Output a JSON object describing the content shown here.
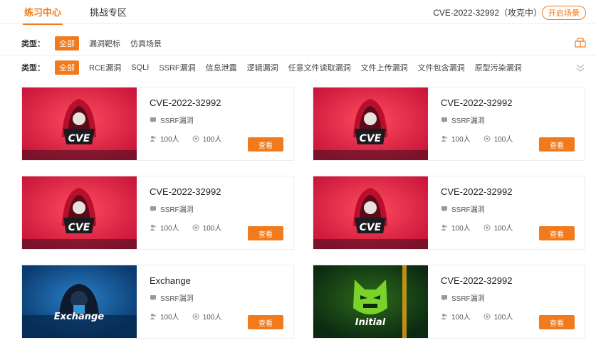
{
  "tabs": [
    {
      "label": "练习中心"
    },
    {
      "label": "挑战专区"
    }
  ],
  "status_text": "CVE-2022-32992（攻克中）",
  "start_button": "开启场景",
  "filter1": {
    "label": "类型：",
    "options": [
      "全部",
      "漏洞靶标",
      "仿真场景"
    ]
  },
  "filter2": {
    "label": "类型：",
    "options": [
      "全部",
      "RCE漏洞",
      "SQLI",
      "SSRF漏洞",
      "信息泄露",
      "逻辑漏洞",
      "任意文件读取漏洞",
      "文件上传漏洞",
      "文件包含漏洞",
      "原型污染漏洞"
    ]
  },
  "cards": [
    {
      "title": "CVE-2022-32992",
      "category": "SSRF漏洞",
      "stat1": "100人",
      "stat2": "100人",
      "button": "查看",
      "art": "CVE"
    },
    {
      "title": "CVE-2022-32992",
      "category": "SSRF漏洞",
      "stat1": "100人",
      "stat2": "100人",
      "button": "查看",
      "art": "CVE"
    },
    {
      "title": "CVE-2022-32992",
      "category": "SSRF漏洞",
      "stat1": "100人",
      "stat2": "100人",
      "button": "查看",
      "art": "CVE"
    },
    {
      "title": "CVE-2022-32992",
      "category": "SSRF漏洞",
      "stat1": "100人",
      "stat2": "100人",
      "button": "查看",
      "art": "CVE"
    },
    {
      "title": "Exchange",
      "category": "SSRF漏洞",
      "stat1": "100人",
      "stat2": "100人",
      "button": "查看",
      "art": "Exchange"
    },
    {
      "title": "CVE-2022-32992",
      "category": "SSRF漏洞",
      "stat1": "100人",
      "stat2": "100人",
      "button": "查看",
      "art": "Initial"
    }
  ],
  "colors": {
    "accent": "#f07a1c",
    "cve_bg": "#c8153a",
    "exchange_bg": "#0a3a6e",
    "initial_bg": "#0b2a12"
  },
  "icons": {
    "tag": "tag-icon",
    "users": "users-icon",
    "target": "target-icon",
    "layers": "layers-icon",
    "expand": "double-chevron-down-icon"
  }
}
